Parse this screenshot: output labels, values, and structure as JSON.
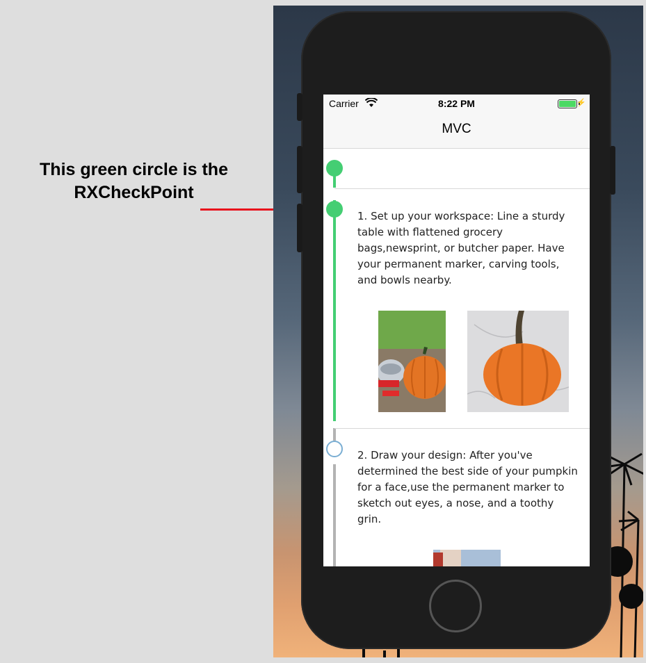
{
  "annotation": {
    "line1": "This green circle is the",
    "line2": "RXCheckPoint"
  },
  "status_bar": {
    "carrier": "Carrier",
    "time": "8:22 PM"
  },
  "nav_bar": {
    "title": "MVC"
  },
  "steps": [
    {
      "text": "1. Set up your workspace: Line a sturdy table with flattened grocery bags,newsprint, or butcher paper. Have your permanent marker, carving tools, and bowls nearby.",
      "status": "completed"
    },
    {
      "text": "2. Draw your design: After you've determined the best side of your pumpkin for a face,use the permanent marker to sketch out eyes, a nose, and a toothy grin.",
      "status": "pending"
    }
  ],
  "colors": {
    "checkpoint_done": "#44ce73",
    "checkpoint_open_border": "#7aaed3",
    "timeline_pending": "#b3b3b3",
    "arrow": "#e8101c",
    "battery": "#4cd964"
  },
  "icons": [
    "wifi-icon",
    "battery-icon",
    "charging-bolt-icon",
    "arrow-icon"
  ]
}
